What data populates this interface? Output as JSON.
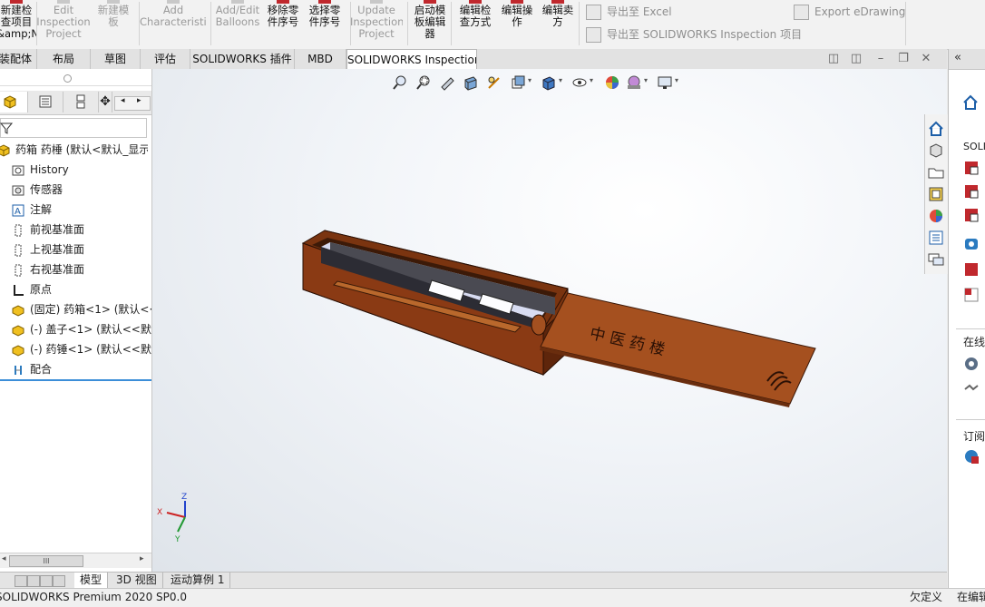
{
  "ribbon": {
    "buttons": [
      {
        "label": "新建检\n查项目\n&amp;N)",
        "enabled": true
      },
      {
        "label": "Edit\nInspection\nProject",
        "enabled": false
      },
      {
        "label": "新建模\n板",
        "enabled": false
      },
      {
        "label": "Add\nCharacteristic",
        "enabled": false
      },
      {
        "label": "Add/Edit\nBalloons",
        "enabled": false
      },
      {
        "label": "移除零\n件序号",
        "enabled": true
      },
      {
        "label": "选择零\n件序号",
        "enabled": true
      },
      {
        "label": "Update\nInspection\nProject",
        "enabled": false
      },
      {
        "label": "启动模\n板编辑\n器",
        "enabled": true
      },
      {
        "label": "编辑检\n查方式",
        "enabled": true
      },
      {
        "label": "编辑操\n作",
        "enabled": true
      },
      {
        "label": "编辑卖\n方",
        "enabled": true
      }
    ],
    "export_excel": "导出至 Excel",
    "export_sw_inspection": "导出至 SOLIDWORKS Inspection 项目",
    "export_edrawing": "Export eDrawing"
  },
  "command_tabs": [
    "装配体",
    "布局",
    "草图",
    "评估",
    "SOLIDWORKS 插件",
    "MBD",
    "SOLIDWORKS Inspection"
  ],
  "active_command_tab": "SOLIDWORKS Inspection",
  "feature_tree": {
    "root": "药箱 药棰  (默认<默认_显示",
    "items": [
      {
        "label": "History",
        "icon": "history-icon"
      },
      {
        "label": "传感器",
        "icon": "sensor-icon"
      },
      {
        "label": "注解",
        "icon": "annotation-icon"
      },
      {
        "label": "前视基准面",
        "icon": "plane-icon"
      },
      {
        "label": "上视基准面",
        "icon": "plane-icon"
      },
      {
        "label": "右视基准面",
        "icon": "plane-icon"
      },
      {
        "label": "原点",
        "icon": "origin-icon"
      },
      {
        "label": "(固定) 药箱<1> (默认<·",
        "icon": "part-icon"
      },
      {
        "label": "(-) 盖子<1> (默认<<默",
        "icon": "part-icon"
      },
      {
        "label": "(-) 药锤<1> (默认<<默",
        "icon": "part-icon"
      },
      {
        "label": "配合",
        "icon": "mate-icon"
      }
    ]
  },
  "hscroll_label": "III",
  "bottom_tabs": [
    "模型",
    "3D 视图",
    "运动算例 1"
  ],
  "active_bottom_tab": "模型",
  "status": {
    "left": "SOLIDWORKS Premium 2020 SP0.0",
    "middle": "欠定义",
    "right": "在编辑"
  },
  "lid_text": "中 医 药 楼",
  "triad": {
    "x": "X",
    "y": "Y",
    "z": "Z"
  },
  "task_pane": {
    "solidworks_label": "SOLI",
    "online_label": "在线",
    "subscribe_label": "订阅"
  },
  "colors": {
    "accent": "#3c8ed8",
    "box_wood": "#8a3a14",
    "lid_wood": "#a5501f"
  }
}
